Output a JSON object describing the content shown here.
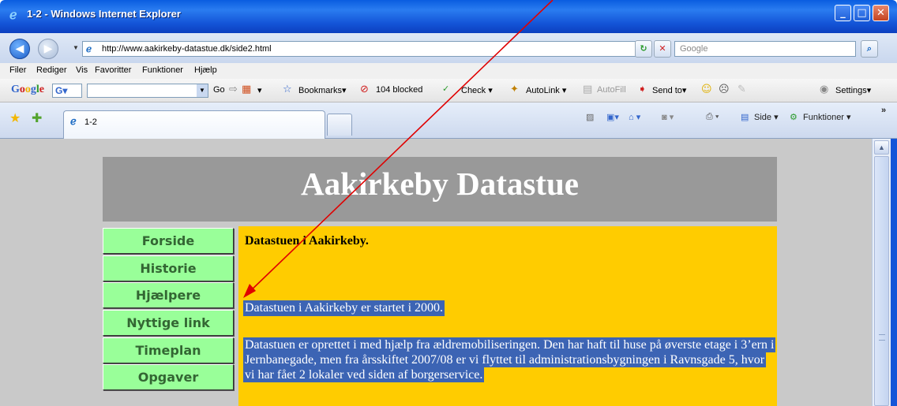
{
  "window": {
    "title": "1-2 - Windows Internet Explorer",
    "minimize": "_",
    "maximize": "□",
    "close": "✕"
  },
  "addressbar": {
    "url": "http://www.aakirkeby-datastue.dk/side2.html",
    "search_placeholder": "Google",
    "refresh": "↻",
    "stop": "✕",
    "search_go": "⌕"
  },
  "menu": [
    "Filer",
    "Rediger",
    "Vis",
    "Favoritter",
    "Funktioner",
    "Hjælp"
  ],
  "google_toolbar": {
    "logo": "Google",
    "g_button": "G▾",
    "go": "Go",
    "bookmarks": "Bookmarks▾",
    "blocked": "104 blocked",
    "check": "Check ▾",
    "autolink": "AutoLink ▾",
    "autofill": "AutoFill",
    "send_to": "Send to▾",
    "settings": "Settings▾"
  },
  "tabs": [
    {
      "label": "1-2"
    }
  ],
  "command_bar": {
    "side": "Side ▾",
    "funktioner": "Funktioner ▾"
  },
  "site": {
    "title": "Aakirkeby Datastue",
    "nav": [
      "Forside",
      "Historie",
      "Hjælpere",
      "Nyttige link",
      "Timeplan",
      "Opgaver"
    ],
    "heading": "Datastuen i Aakirkeby.",
    "paragraphs": [
      "Datastuen i Aakirkeby er startet i 2000.",
      "Datastuen er oprettet i med hjælp fra ældremobiliseringen. Den har haft til huse på øverste etage i 3’ern i Jernbanegade, men fra årsskiftet 2007/08 er vi flyttet til administrationsbygningen i Ravnsgade 5, hvor vi har fået 2 lokaler ved siden af borgerservice."
    ]
  },
  "colors": {
    "nav_bg": "#99ff99",
    "content_bg": "#ffcc00",
    "header_bg": "#999999",
    "selection": "#3c64b4",
    "arrow": "#e00000"
  }
}
